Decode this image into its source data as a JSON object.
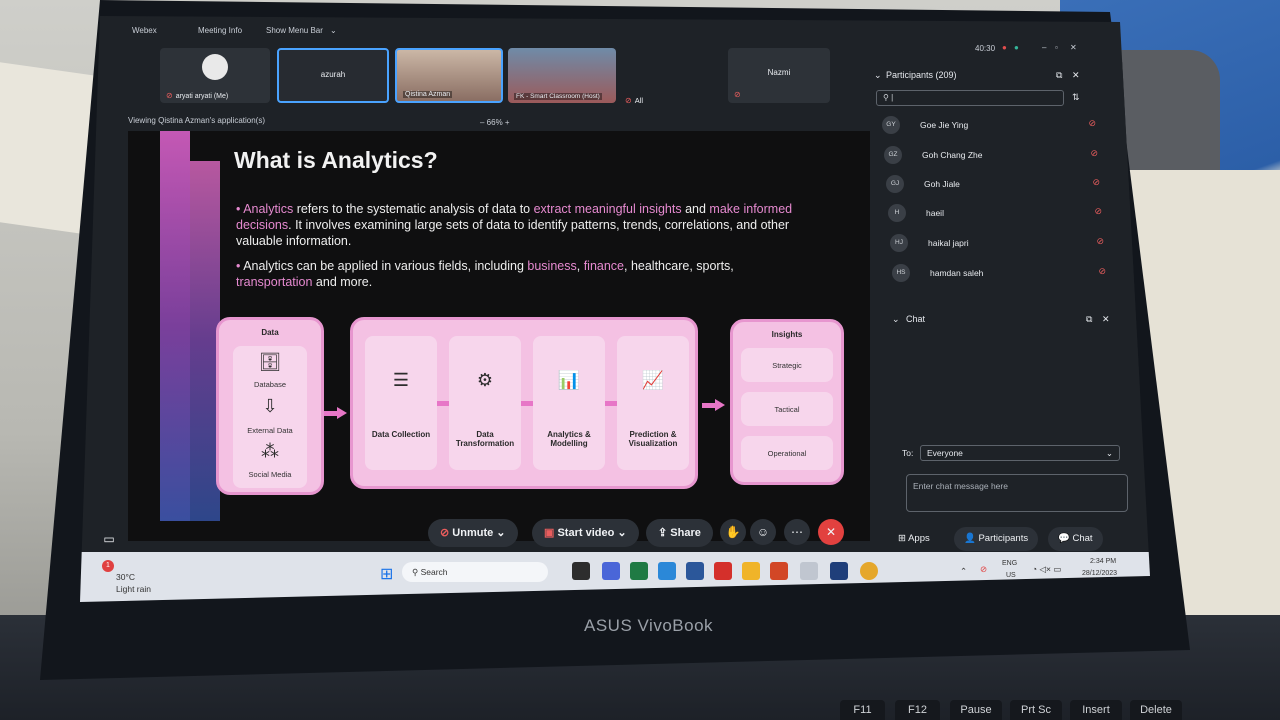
{
  "webex": {
    "app_name": "Webex",
    "meeting_info": "Meeting Info",
    "show_menu_bar": "Show Menu Bar",
    "timer": "40:30"
  },
  "tiles": [
    {
      "label": "aryati aryati (Me)"
    },
    {
      "label": "azurah"
    },
    {
      "label": "Qistina Azman"
    },
    {
      "label": "FK - Smart Classroom (Host)"
    },
    {
      "label": "All"
    },
    {
      "label": "Nazmi"
    }
  ],
  "viewing": "Viewing Qistina Azman's application(s)",
  "zoom": "66%",
  "slide": {
    "title": "What is Analytics?",
    "bullet1_a": "Analytics",
    "bullet1_b": " refers to the systematic analysis of data to ",
    "bullet1_c": "extract meaningful insights",
    "bullet1_d": " and ",
    "bullet1_e": "make informed decisions",
    "bullet1_f": ". It involves examining large sets of data to identify patterns, trends, correlations, and other valuable information.",
    "bullet2_a": "Analytics can be applied in various fields, including ",
    "bullet2_b": "business",
    "bullet2_c": ", ",
    "bullet2_d": "finance",
    "bullet2_e": ", healthcare, sports, ",
    "bullet2_f": "transportation",
    "bullet2_g": " and more.",
    "data_card": {
      "title": "Data",
      "items": [
        "Database",
        "External Data",
        "Social Media"
      ]
    },
    "steps": [
      "Data Collection",
      "Data Transformation",
      "Analytics & Modelling",
      "Prediction & Visualization"
    ],
    "insights": {
      "title": "Insights",
      "items": [
        "Strategic",
        "Tactical",
        "Operational"
      ]
    }
  },
  "panel": {
    "participants_title": "Participants (209)",
    "participants": [
      {
        "initials": "GY",
        "name": "Goe Jie Ying"
      },
      {
        "initials": "GZ",
        "name": "Goh Chang Zhe"
      },
      {
        "initials": "GJ",
        "name": "Goh Jiale"
      },
      {
        "initials": "H",
        "name": "haeil"
      },
      {
        "initials": "HJ",
        "name": "haikal japri"
      },
      {
        "initials": "HS",
        "name": "hamdan saleh"
      }
    ],
    "chat_title": "Chat",
    "to_label": "To:",
    "to_value": "Everyone",
    "chat_placeholder": "Enter chat message here",
    "apps": "Apps",
    "participants_btn": "Participants",
    "chat_btn": "Chat"
  },
  "controls": {
    "unmute": "Unmute",
    "start_video": "Start video",
    "share": "Share"
  },
  "taskbar": {
    "weather_temp": "30°C",
    "weather_desc": "Light rain",
    "search": "Search",
    "lang": "ENG",
    "region": "US",
    "time": "2:34 PM",
    "date": "28/12/2023",
    "badge": "1"
  },
  "laptop": {
    "brand": "ASUS VivoBook",
    "keys": [
      "F11",
      "F12",
      "Pause",
      "Prt Sc",
      "Insert",
      "Delete"
    ]
  }
}
